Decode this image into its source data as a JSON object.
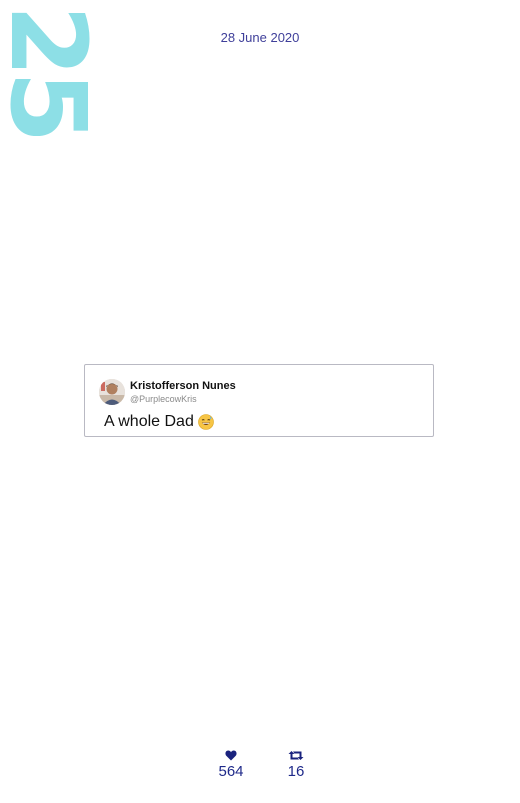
{
  "day": "25",
  "date": "28 June 2020",
  "tweet": {
    "author_name": "Kristofferson Nunes",
    "author_handle": "@PurplecowKris",
    "text": "A whole Dad",
    "emoji_icon": "grinning-sweat-emoji-icon",
    "avatar_icon": "profile-avatar"
  },
  "stats": {
    "likes": "564",
    "retweets": "16",
    "likes_icon": "heart-icon",
    "retweets_icon": "retweet-icon",
    "color": "#1a237e"
  },
  "colors": {
    "day_number": "#8ddfe6",
    "date": "#3f3f9a",
    "card_border": "#b9b9c3"
  }
}
